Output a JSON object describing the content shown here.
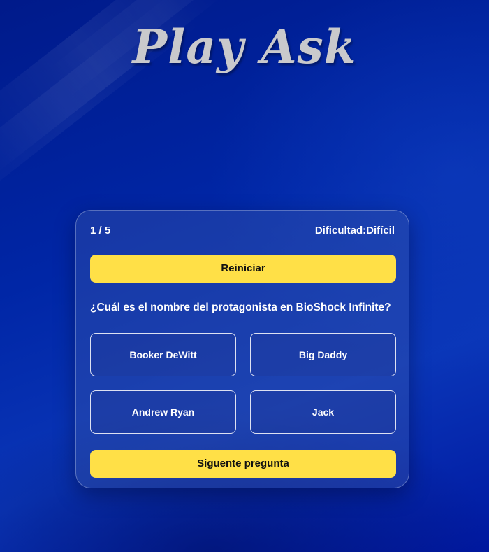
{
  "app": {
    "title": "Play Ask"
  },
  "quiz": {
    "progress": "1 / 5",
    "difficulty_label": "Dificultad:",
    "difficulty_value": "Difícil",
    "restart_label": "Reiniciar",
    "question": "¿Cuál es el nombre del protagonista en BioShock Infinite?",
    "answers": [
      {
        "label": "Booker DeWitt"
      },
      {
        "label": "Big Daddy"
      },
      {
        "label": "Andrew Ryan"
      },
      {
        "label": "Jack"
      }
    ],
    "next_label": "Siguente pregunta"
  },
  "colors": {
    "background": "#0024a4",
    "accent_button": "#ffe047",
    "title_text": "#c9c9cc",
    "card_border": "#ffffff"
  }
}
